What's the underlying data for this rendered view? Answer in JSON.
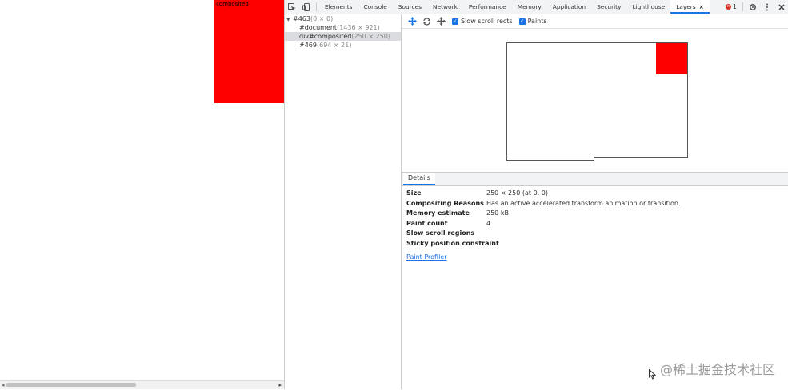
{
  "viewport": {
    "red_box_label": "composited"
  },
  "devtools": {
    "tabs": [
      "Elements",
      "Console",
      "Sources",
      "Network",
      "Performance",
      "Memory",
      "Application",
      "Security",
      "Lighthouse"
    ],
    "active_tab": "Layers",
    "active_tab_close": "×",
    "error_count": "1",
    "error_dot": "×"
  },
  "tree": {
    "root": {
      "name": "#463",
      "dims": "(0 × 0)"
    },
    "children": [
      {
        "name": "#document",
        "dims": "(1436 × 921)"
      },
      {
        "name": "div#composited",
        "dims": "(250 × 250)"
      },
      {
        "name": "#469",
        "dims": "(694 × 21)"
      }
    ]
  },
  "layers_toolbar": {
    "slow_scroll_rects_label": "Slow scroll rects",
    "paints_label": "Paints",
    "check_mark": "✓"
  },
  "details": {
    "tab_label": "Details",
    "rows": [
      {
        "key": "Size",
        "value": "250 × 250 (at 0, 0)"
      },
      {
        "key": "Compositing Reasons",
        "value": "Has an active accelerated transform animation or transition."
      },
      {
        "key": "Memory estimate",
        "value": "250 kB"
      },
      {
        "key": "Paint count",
        "value": "4"
      },
      {
        "key": "Slow scroll regions",
        "value": ""
      },
      {
        "key": "Sticky position constraint",
        "value": ""
      }
    ],
    "paint_profiler_link": "Paint Profiler"
  },
  "watermark": "@稀土掘金技术社区",
  "colors": {
    "accent": "#1a73e8",
    "composited_layer": "#ff0000",
    "error": "#d93025"
  }
}
